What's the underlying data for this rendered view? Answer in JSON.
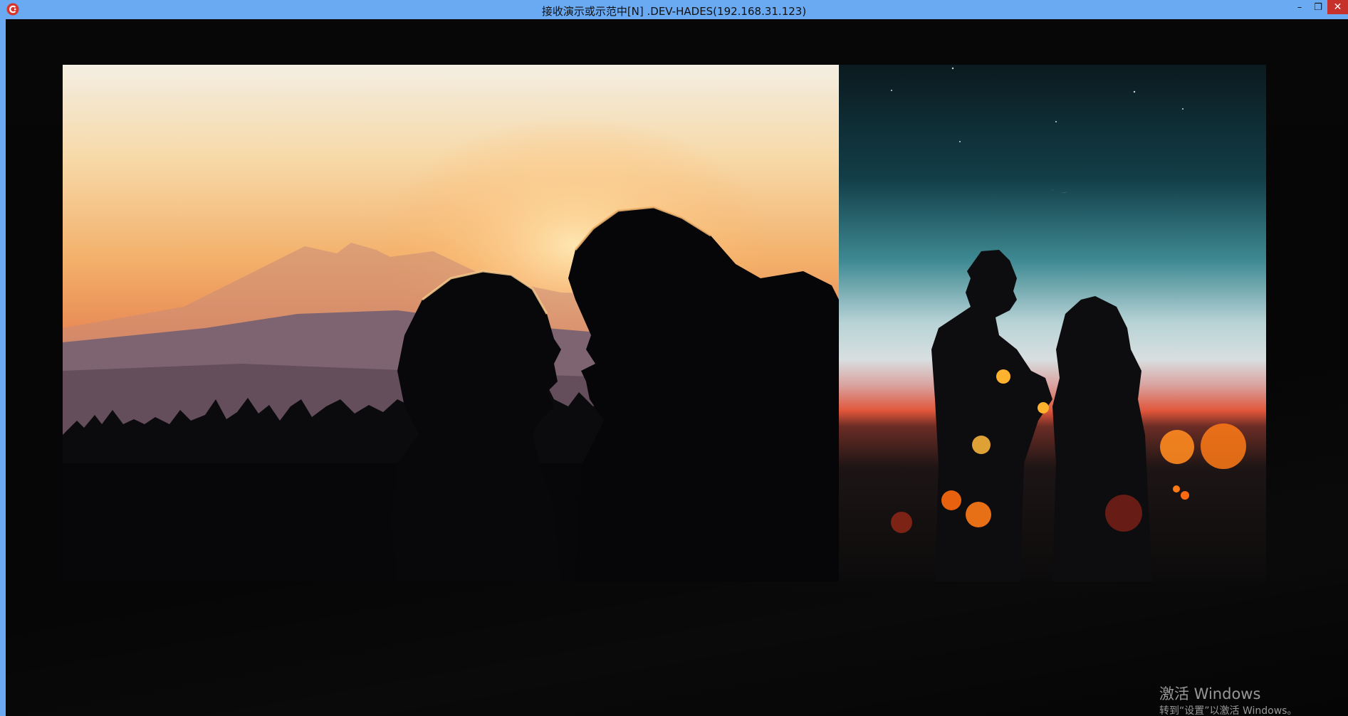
{
  "window": {
    "title": "接收演示或示范中[N] .DEV-HADES(192.168.31.123)",
    "app_icon": "app-logo-icon",
    "buttons": {
      "minimize": "–",
      "maximize": "❐",
      "close": "✕"
    }
  },
  "slide": {
    "images": [
      {
        "name": "couple-sunset-photo"
      },
      {
        "name": "couple-moon-photo"
      }
    ]
  },
  "activation_watermark": {
    "title": "激活 Windows",
    "subtitle": "转到“设置”以激活 Windows。"
  },
  "colors": {
    "titlebar": "#6aaaf2",
    "close_button": "#c7312b",
    "stage": "#060606"
  }
}
